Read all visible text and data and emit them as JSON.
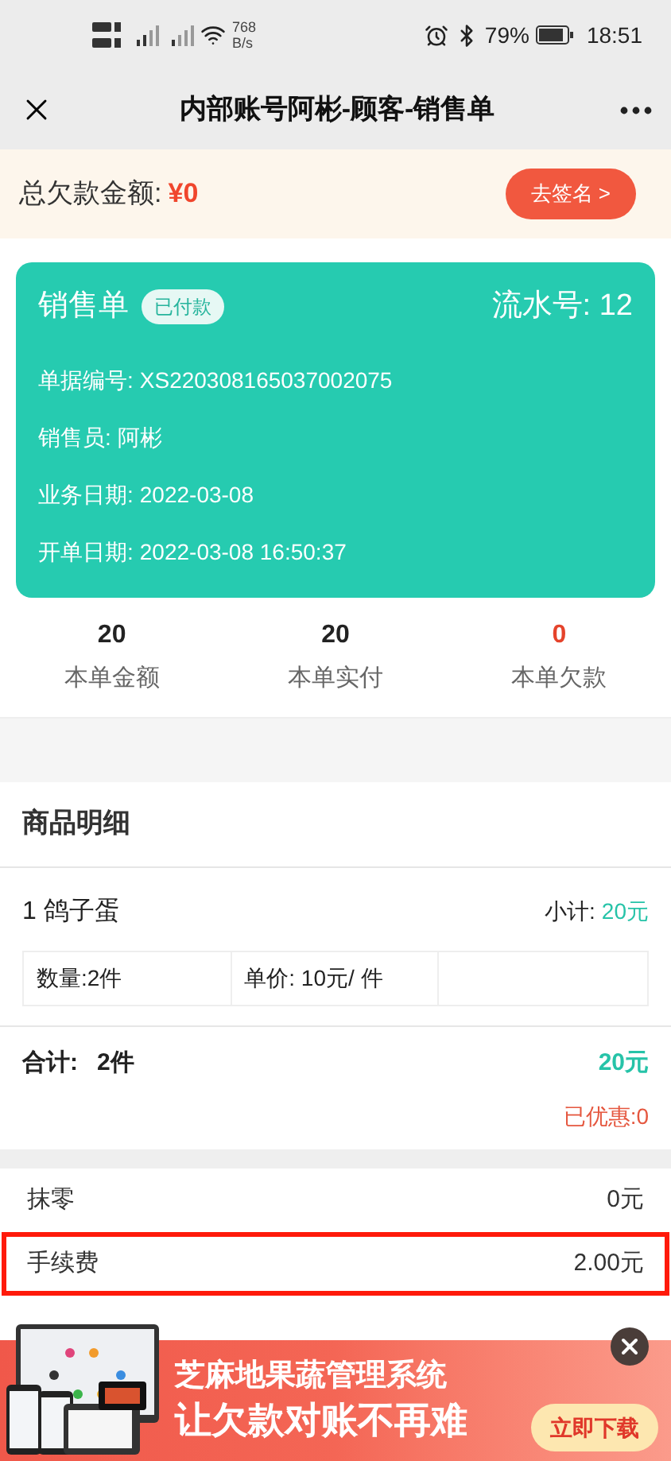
{
  "status_bar": {
    "network_speed": "768",
    "network_unit": "B/s",
    "battery": "79%",
    "time": "18:51"
  },
  "nav": {
    "title": "内部账号阿彬-顾客-销售单"
  },
  "debt": {
    "label": "总欠款金额:",
    "amount": "¥0",
    "button": "去签名 >"
  },
  "order": {
    "title": "销售单",
    "badge": "已付款",
    "serial": "流水号: 12",
    "fields": [
      {
        "label": "单据编号:",
        "value": "XS220308165037002075"
      },
      {
        "label": "销售员:",
        "value": "阿彬"
      },
      {
        "label": "业务日期:",
        "value": "2022-03-08"
      },
      {
        "label": "开单日期:",
        "value": "2022-03-08 16:50:37"
      }
    ]
  },
  "stats": [
    {
      "value": "20",
      "label": "本单金额",
      "kind": "normal"
    },
    {
      "value": "20",
      "label": "本单实付",
      "kind": "normal"
    },
    {
      "value": "0",
      "label": "本单欠款",
      "kind": "alert"
    }
  ],
  "details": {
    "heading": "商品明细",
    "items": [
      {
        "name": "1 鸽子蛋",
        "subtotal_label": "小计:",
        "subtotal": "20元",
        "quantity": "数量:2件",
        "price": "单价: 10元/ 件"
      }
    ],
    "total_label": "合计:",
    "total_count": "2件",
    "total_amount": "20元",
    "discount": "已优惠:0"
  },
  "extras": [
    {
      "label": "抹零",
      "value": "0元",
      "highlighted": false
    },
    {
      "label": "手续费",
      "value": "2.00元",
      "highlighted": true
    }
  ],
  "ad": {
    "title": "芝麻地果蔬管理系统",
    "slogan": "让欠款对账不再难",
    "button": "立即下载"
  }
}
